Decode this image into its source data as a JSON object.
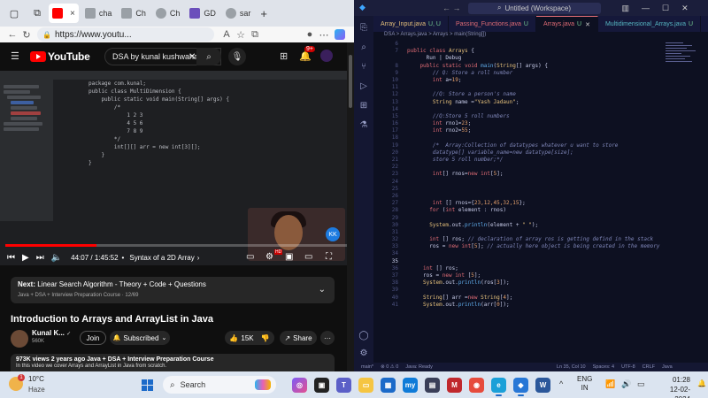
{
  "browser": {
    "tabs": [
      {
        "label": "",
        "favicon_color": "#ff0000",
        "active": true
      },
      {
        "label": "cha",
        "favicon_color": "#9aa0a6"
      },
      {
        "label": "Ch",
        "favicon_color": "#9aa0a6"
      },
      {
        "label": "Ch",
        "favicon_color": "#9aa0a6"
      },
      {
        "label": "GD",
        "favicon_color": "#6b4fbb"
      },
      {
        "label": "sar",
        "favicon_color": "#9aa0a6"
      }
    ],
    "tab_close": "×",
    "new_tab": "+",
    "url": "https://www.youtu...",
    "zoom_icon": "A"
  },
  "youtube": {
    "logo_text": "YouTube",
    "search_value": "DSA by kunal kushwaha",
    "notifications": "9+",
    "video": {
      "ide_code": [
        "package com.kunal;",
        "",
        "public class MultiDimension {",
        "    public static void main(String[] args) {",
        "        /*",
        "            1 2 3",
        "            4 5 6",
        "            7 8 9",
        "        */",
        "",
        "        int[][] arr = new int[3][];",
        "",
        "    }",
        "}"
      ],
      "progress_fraction": 0.265,
      "time": "44:07 / 1:45:52",
      "chapter": "Syntax of a 2D Array",
      "chapter_chevron": "›",
      "hd": "HD",
      "facecam_logo": "KK"
    },
    "next": {
      "prefix": "Next:",
      "title": "Linear Search Algorithm - Theory + Code + Questions",
      "sub": "Java + DSA + Interview Preparation Course · 12/69"
    },
    "title": "Introduction to Arrays and ArrayList in Java",
    "channel": "Kunal K...",
    "verified": "✓",
    "subscribers": "560K",
    "join": "Join",
    "subscribed": "Subscribed",
    "likes": "15K",
    "share": "Share",
    "more": "···",
    "description": {
      "stats": "973K views  2 years ago  Java + DSA + Interview Preparation Course",
      "text": "In this video we cover Arrays and ArrayList in Java from scratch."
    }
  },
  "vscode": {
    "search": "Untitled (Workspace)",
    "tabs": [
      {
        "label": "Array_Input.java",
        "badge": "U, U"
      },
      {
        "label": "Passing_Functions.java",
        "badge": "U"
      },
      {
        "label": "Arrays.java",
        "badge": "U",
        "active": true
      },
      {
        "label": "Multidimensional_Arrays.java",
        "badge": "U"
      }
    ],
    "breadcrumb": "DSA > Arrays.java > Arrays > main(String[])",
    "status": [
      "main*",
      "⊗ 0 ⚠ 0",
      "Java: Ready",
      "Ln 35, Col 10",
      "Spaces: 4",
      "UTF-8",
      "CRLF",
      "Java"
    ],
    "lines": [
      {
        "n": "6",
        "parts": []
      },
      {
        "n": "7",
        "parts": [
          {
            "c": "k",
            "t": "public class "
          },
          {
            "c": "cl",
            "t": "Arrays"
          },
          {
            "c": "",
            "t": " {"
          }
        ]
      },
      {
        "n": "",
        "parts": [
          {
            "c": "",
            "t": "      Run | Debug"
          }
        ]
      },
      {
        "n": "8",
        "parts": [
          {
            "c": "k",
            "t": "    public static void "
          },
          {
            "c": "f",
            "t": "main"
          },
          {
            "c": "",
            "t": "("
          },
          {
            "c": "t",
            "t": "String"
          },
          {
            "c": "",
            "t": "[] args) {"
          }
        ]
      },
      {
        "n": "9",
        "parts": [
          {
            "c": "c",
            "t": "        // Q: Store a roll number"
          }
        ]
      },
      {
        "n": "10",
        "parts": [
          {
            "c": "k",
            "t": "        int "
          },
          {
            "c": "",
            "t": "a="
          },
          {
            "c": "n",
            "t": "19"
          },
          {
            "c": "",
            "t": ";"
          }
        ]
      },
      {
        "n": "11",
        "parts": []
      },
      {
        "n": "12",
        "parts": [
          {
            "c": "c",
            "t": "        //Q: Store a person's name"
          }
        ]
      },
      {
        "n": "13",
        "parts": [
          {
            "c": "t",
            "t": "        String "
          },
          {
            "c": "",
            "t": "name ="
          },
          {
            "c": "s",
            "t": "\"Yash Jadaun\""
          },
          {
            "c": "",
            "t": ";"
          }
        ]
      },
      {
        "n": "14",
        "parts": []
      },
      {
        "n": "15",
        "parts": [
          {
            "c": "c",
            "t": "        //Q:Store 5 roll numbers"
          }
        ]
      },
      {
        "n": "16",
        "parts": [
          {
            "c": "k",
            "t": "        int "
          },
          {
            "c": "",
            "t": "rno1="
          },
          {
            "c": "n",
            "t": "23"
          },
          {
            "c": "",
            "t": ";"
          }
        ]
      },
      {
        "n": "17",
        "parts": [
          {
            "c": "k",
            "t": "        int "
          },
          {
            "c": "",
            "t": "rno2="
          },
          {
            "c": "n",
            "t": "55"
          },
          {
            "c": "",
            "t": ";"
          }
        ]
      },
      {
        "n": "18",
        "parts": []
      },
      {
        "n": "19",
        "parts": [
          {
            "c": "c",
            "t": "        /*  Array:Collection of datatypes whatever u want to store"
          }
        ]
      },
      {
        "n": "20",
        "parts": [
          {
            "c": "c",
            "t": "        datatype[] variable_name=new datatype[size];"
          }
        ]
      },
      {
        "n": "21",
        "parts": [
          {
            "c": "c",
            "t": "        store 5 roll number;*/"
          }
        ]
      },
      {
        "n": "22",
        "parts": []
      },
      {
        "n": "23",
        "parts": [
          {
            "c": "k",
            "t": "        int"
          },
          {
            "c": "",
            "t": "[] rnos="
          },
          {
            "c": "k",
            "t": "new int"
          },
          {
            "c": "",
            "t": "["
          },
          {
            "c": "n",
            "t": "5"
          },
          {
            "c": "",
            "t": "];"
          }
        ]
      },
      {
        "n": "24",
        "parts": []
      },
      {
        "n": "25",
        "parts": []
      },
      {
        "n": "26",
        "parts": []
      },
      {
        "n": "27",
        "parts": [
          {
            "c": "k",
            "t": "        int "
          },
          {
            "c": "",
            "t": "[] rnos={"
          },
          {
            "c": "n",
            "t": "23,12,45,32,15"
          },
          {
            "c": "",
            "t": "};"
          }
        ]
      },
      {
        "n": "28",
        "parts": [
          {
            "c": "k",
            "t": "       for "
          },
          {
            "c": "",
            "t": "("
          },
          {
            "c": "k",
            "t": "int "
          },
          {
            "c": "",
            "t": "element : rnos)"
          }
        ]
      },
      {
        "n": "29",
        "parts": []
      },
      {
        "n": "30",
        "parts": [
          {
            "c": "t",
            "t": "       System"
          },
          {
            "c": "",
            "t": ".out."
          },
          {
            "c": "f",
            "t": "println"
          },
          {
            "c": "",
            "t": "(element + "
          },
          {
            "c": "s",
            "t": "\" \""
          },
          {
            "c": "",
            "t": ");"
          }
        ]
      },
      {
        "n": "31",
        "parts": []
      },
      {
        "n": "32",
        "parts": [
          {
            "c": "k",
            "t": "       int "
          },
          {
            "c": "",
            "t": "[] ros; "
          },
          {
            "c": "c",
            "t": "// declaration of array ros is getting defind in the stack"
          }
        ]
      },
      {
        "n": "33",
        "parts": [
          {
            "c": "",
            "t": "       ros = "
          },
          {
            "c": "k",
            "t": "new int"
          },
          {
            "c": "",
            "t": "["
          },
          {
            "c": "n",
            "t": "5"
          },
          {
            "c": "",
            "t": "]; "
          },
          {
            "c": "c",
            "t": "// actually here object is being created in the memory"
          }
        ]
      },
      {
        "n": "34",
        "parts": []
      },
      {
        "n": "35",
        "parts": []
      },
      {
        "n": "36",
        "parts": [
          {
            "c": "k",
            "t": "     int "
          },
          {
            "c": "",
            "t": "[] ros;"
          }
        ]
      },
      {
        "n": "37",
        "parts": [
          {
            "c": "",
            "t": "     ros = "
          },
          {
            "c": "k",
            "t": "new int "
          },
          {
            "c": "",
            "t": "["
          },
          {
            "c": "n",
            "t": "5"
          },
          {
            "c": "",
            "t": "];"
          }
        ]
      },
      {
        "n": "38",
        "parts": [
          {
            "c": "t",
            "t": "     System"
          },
          {
            "c": "",
            "t": ".out."
          },
          {
            "c": "f",
            "t": "println"
          },
          {
            "c": "",
            "t": "(ros["
          },
          {
            "c": "n",
            "t": "3"
          },
          {
            "c": "",
            "t": "]);"
          }
        ]
      },
      {
        "n": "39",
        "parts": []
      },
      {
        "n": "40",
        "parts": [
          {
            "c": "t",
            "t": "     String"
          },
          {
            "c": "",
            "t": "[] arr ="
          },
          {
            "c": "k",
            "t": "new "
          },
          {
            "c": "t",
            "t": "String"
          },
          {
            "c": "",
            "t": "["
          },
          {
            "c": "n",
            "t": "4"
          },
          {
            "c": "",
            "t": "];"
          }
        ]
      },
      {
        "n": "41",
        "parts": [
          {
            "c": "t",
            "t": "     System"
          },
          {
            "c": "",
            "t": ".out."
          },
          {
            "c": "f",
            "t": "println"
          },
          {
            "c": "",
            "t": "(arr["
          },
          {
            "c": "n",
            "t": "0"
          },
          {
            "c": "",
            "t": "]);"
          }
        ]
      }
    ]
  },
  "taskbar": {
    "weather_temp": "10°C",
    "weather_desc": "Haze",
    "weather_badge": "1",
    "search": "Search",
    "lang_1": "ENG",
    "lang_2": "IN",
    "time": "01:28",
    "date": "12-02-2024"
  }
}
